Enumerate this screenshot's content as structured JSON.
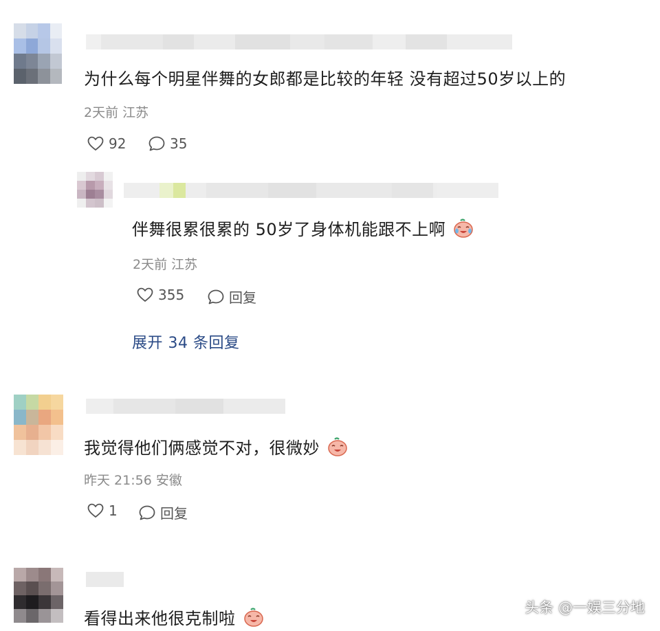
{
  "comments": [
    {
      "text": "为什么每个明星伴舞的女郎都是比较的年轻 没有超过50岁以上的",
      "meta": "2天前 江苏",
      "likes": "92",
      "replies_count": "35",
      "reply": {
        "text": "伴舞很累很累的 50岁了身体机能跟不上啊",
        "meta": "2天前 江苏",
        "likes": "355",
        "reply_label": "回复"
      },
      "expand_label": "展开 34 条回复"
    },
    {
      "text": "我觉得他们俩感觉不对，很微妙",
      "meta": "昨天 21:56 安徽",
      "likes": "1",
      "reply_label": "回复"
    },
    {
      "text": "看得出来他很克制啦"
    }
  ],
  "watermark": "头条 @一娱三分地",
  "icons": {
    "like": "heart-outline-icon",
    "comment": "speech-bubble-icon",
    "emoji": "crying-laughing-emoji-icon"
  },
  "colors": {
    "link": "#2a4a86",
    "meta": "#8a8a8a",
    "text": "#1e1e1e"
  }
}
